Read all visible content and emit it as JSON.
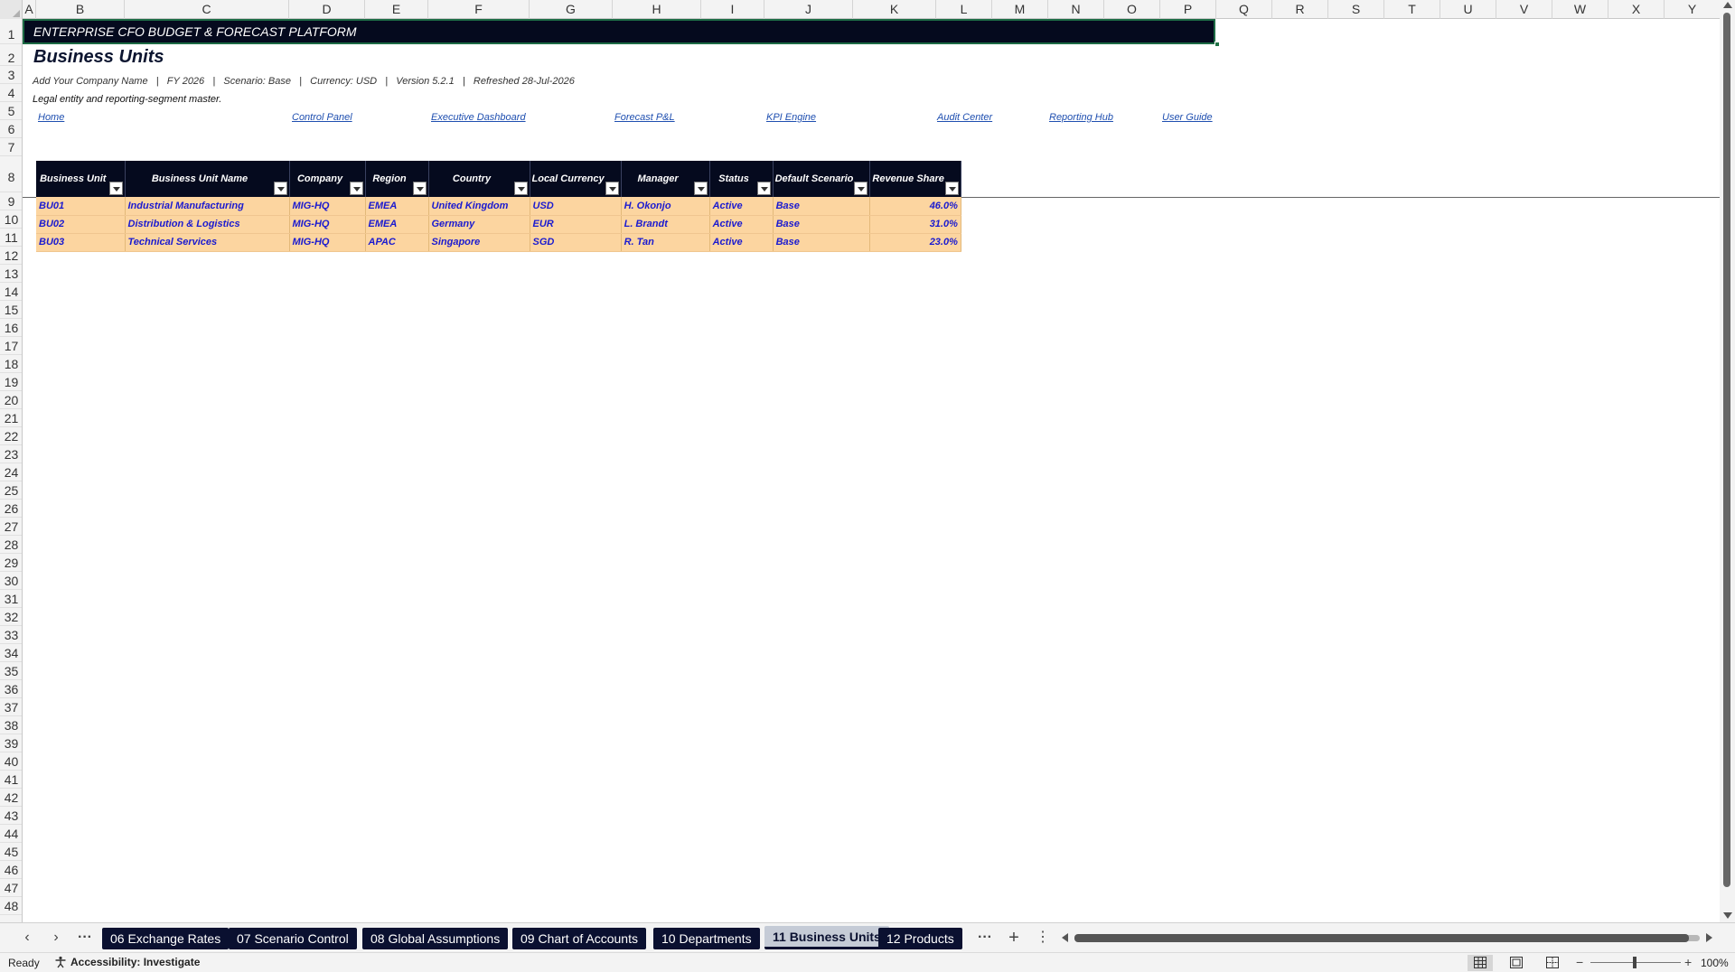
{
  "columns": [
    "A",
    "B",
    "C",
    "D",
    "E",
    "F",
    "G",
    "H",
    "I",
    "J",
    "K",
    "L",
    "M",
    "N",
    "O",
    "P",
    "Q",
    "R",
    "S",
    "T",
    "U",
    "V",
    "W",
    "X",
    "Y"
  ],
  "rows": [
    "1",
    "2",
    "3",
    "4",
    "5",
    "6",
    "7",
    "8",
    "9",
    "10",
    "11",
    "12",
    "13",
    "14",
    "15",
    "16",
    "17",
    "18",
    "19",
    "20",
    "21",
    "22",
    "23",
    "24",
    "25",
    "26",
    "27",
    "28",
    "29",
    "30",
    "31",
    "32",
    "33",
    "34",
    "35",
    "36",
    "37",
    "38",
    "39",
    "40",
    "41",
    "42",
    "43",
    "44",
    "45",
    "46",
    "47",
    "48"
  ],
  "sheet": {
    "banner": "ENTERPRISE CFO BUDGET & FORECAST PLATFORM",
    "title": "Business Units",
    "info": "Add Your Company Name   |   FY 2026   |   Scenario: Base   |   Currency: USD   |   Version 5.2.1   |   Refreshed 28-Jul-2026",
    "subtitle": "Legal entity and reporting-segment master.",
    "nav": [
      "Home",
      "Control Panel",
      "Executive Dashboard",
      "Forecast P&L",
      "KPI Engine",
      "Audit Center",
      "Reporting Hub",
      "User Guide"
    ]
  },
  "table": {
    "headers": [
      "Business Unit",
      "Business Unit Name",
      "Company",
      "Region",
      "Country",
      "Local Currency",
      "Manager",
      "Status",
      "Default Scenario",
      "Revenue Share"
    ],
    "rows": [
      [
        "BU01",
        "Industrial Manufacturing",
        "MIG-HQ",
        "EMEA",
        "United Kingdom",
        "USD",
        "H. Okonjo",
        "Active",
        "Base",
        "46.0%"
      ],
      [
        "BU02",
        "Distribution & Logistics",
        "MIG-HQ",
        "EMEA",
        "Germany",
        "EUR",
        "L. Brandt",
        "Active",
        "Base",
        "31.0%"
      ],
      [
        "BU03",
        "Technical Services",
        "MIG-HQ",
        "APAC",
        "Singapore",
        "SGD",
        "R. Tan",
        "Active",
        "Base",
        "23.0%"
      ]
    ]
  },
  "tabs": {
    "sheets": [
      "06 Exchange Rates",
      "07 Scenario Control",
      "08 Global Assumptions",
      "09 Chart of Accounts",
      "10 Departments",
      "11 Business Units",
      "12 Products"
    ],
    "active": "11 Business Units",
    "more_label": "···",
    "add_label": "+",
    "options_label": "⋮",
    "prev_label": "‹",
    "next_label": "›"
  },
  "status": {
    "ready": "Ready",
    "accessibility": "Accessibility: Investigate",
    "zoom": "100%",
    "zoom_minus": "−",
    "zoom_plus": "+"
  },
  "colors": {
    "header_bg": "#050a1e",
    "row_fill": "#fcd5a0",
    "row_text": "#1a1ad0",
    "link": "#1f4fb0",
    "selection": "#217346"
  }
}
